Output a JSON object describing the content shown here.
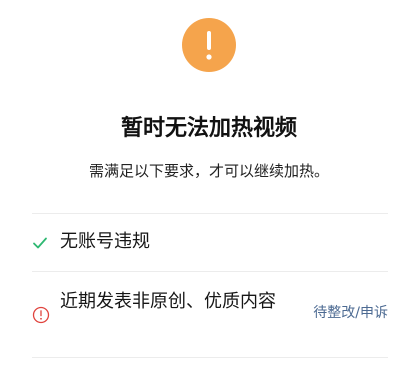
{
  "header": {
    "icon": "exclamation-icon",
    "icon_color": "#F5A44C",
    "title": "暂时无法加热视频",
    "subtitle": "需满足以下要求，才可以继续加热。"
  },
  "requirements": [
    {
      "status": "met",
      "icon": "check-icon",
      "icon_color": "#2EB872",
      "label": "无账号违规"
    },
    {
      "status": "unmet",
      "icon": "info-circle-icon",
      "icon_color": "#E0443E",
      "label": "近期发表非原创、优质内容",
      "action": "待整改/申诉",
      "action_color": "#4C6A92"
    }
  ]
}
